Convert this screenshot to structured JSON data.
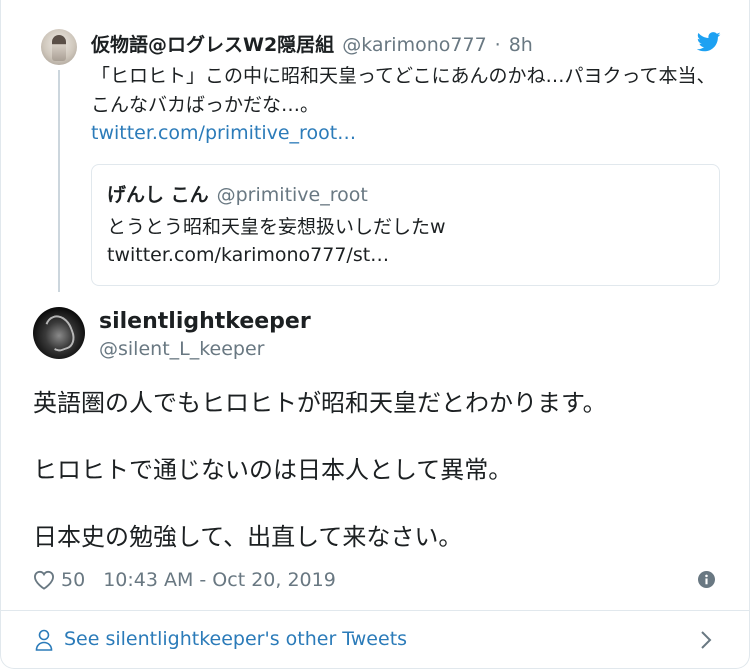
{
  "parent_tweet": {
    "display_name": "仮物語@ログレスW2隠居組",
    "handle": "@karimono777",
    "separator": "·",
    "time": "8h",
    "text": "「ヒロヒト」この中に昭和天皇ってどこにあんのかね…パヨクって本当、こんなバカばっかだな…。",
    "link": "twitter.com/primitive_root…"
  },
  "quoted_tweet": {
    "display_name": "げんし こん",
    "handle": "@primitive_root",
    "text": "とうとう昭和天皇を妄想扱いしだしたw",
    "link": "twitter.com/karimono777/st…"
  },
  "main_tweet": {
    "display_name": "silentlightkeeper",
    "handle": "@silent_L_keeper",
    "lines": [
      "英語圏の人でもヒロヒトが昭和天皇だとわかります。",
      "ヒロヒトで通じないのは日本人として異常。",
      "日本史の勉強して、出直して来なさい。"
    ],
    "likes": "50",
    "timestamp": "10:43 AM - Oct 20, 2019"
  },
  "footer": {
    "see_more_label": "See silentlightkeeper's other Tweets"
  },
  "icons": {
    "brand": "twitter-bird-icon",
    "like": "heart-icon",
    "info": "info-icon",
    "profile": "person-icon",
    "navigate": "chevron-right-icon"
  },
  "colors": {
    "accent": "#1da1f2",
    "link": "#2b7bb9",
    "secondary_text": "#697882",
    "primary_text": "#1c2022",
    "border": "#e1e8ed"
  }
}
